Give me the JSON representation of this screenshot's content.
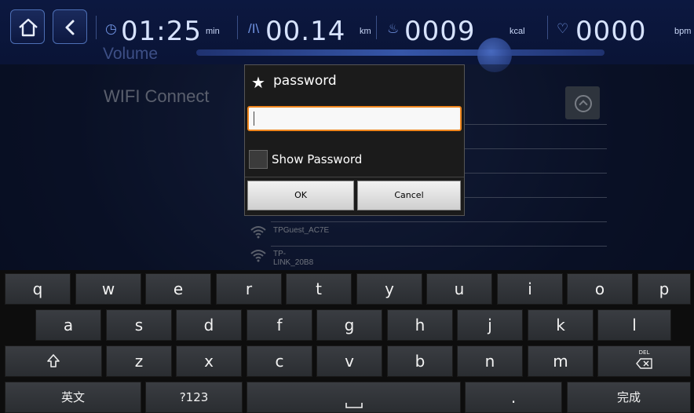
{
  "topbar": {
    "time": {
      "value": "01:25",
      "unit": "min"
    },
    "distance": {
      "value": "00.14",
      "unit": "km"
    },
    "calories": {
      "value": "0009",
      "unit": "kcal"
    },
    "heart_rate": {
      "value": "0000",
      "unit": "bpm"
    },
    "volume_label": "Volume",
    "volume_level_percent": 73
  },
  "wifi": {
    "title": "WIFI Connect",
    "networks": [
      "TPGuest_AC7E",
      "TP-LINK_20B8"
    ]
  },
  "dialog": {
    "title": "password",
    "password_value": "",
    "show_password_label": "Show Password",
    "show_password_checked": false,
    "ok_label": "OK",
    "cancel_label": "Cancel",
    "accent_color": "#f0861e"
  },
  "keyboard": {
    "row1": [
      "q",
      "w",
      "e",
      "r",
      "t",
      "y",
      "u",
      "i",
      "o",
      "p"
    ],
    "row2": [
      "a",
      "s",
      "d",
      "f",
      "g",
      "h",
      "j",
      "k",
      "l"
    ],
    "row3": [
      "z",
      "x",
      "c",
      "v",
      "b",
      "n",
      "m"
    ],
    "row4": {
      "lang": "英文",
      "symbols": "?123",
      "period": ".",
      "done": "完成"
    },
    "delete_hint": "DEL"
  }
}
